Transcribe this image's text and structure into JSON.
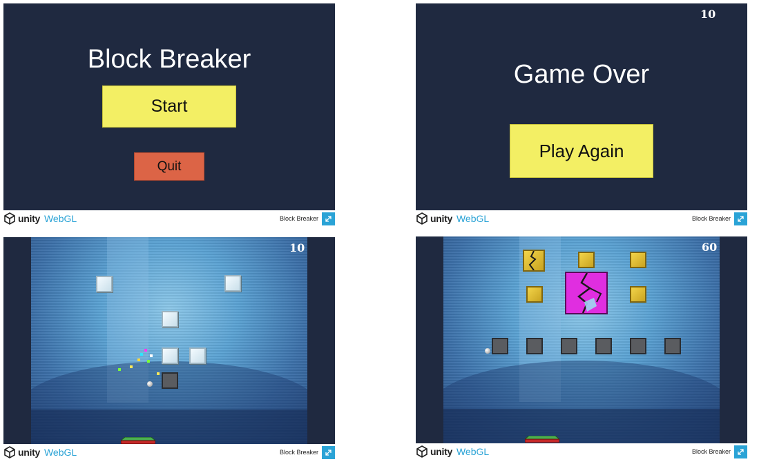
{
  "brand": {
    "unity": "unity",
    "webgl": "WebGL"
  },
  "footer_title": "Block Breaker",
  "start_menu": {
    "title": "Block Breaker",
    "start_label": "Start",
    "quit_label": "Quit"
  },
  "game_over": {
    "score": "10",
    "title": "Game Over",
    "play_again_label": "Play Again"
  },
  "level1": {
    "score": "10"
  },
  "level2": {
    "score": "60"
  },
  "colors": {
    "screen_bg": "#1f2940",
    "yellow_button": "#f3ef64",
    "orange_button": "#dc6446",
    "webgl_blue": "#2aa3d6"
  }
}
